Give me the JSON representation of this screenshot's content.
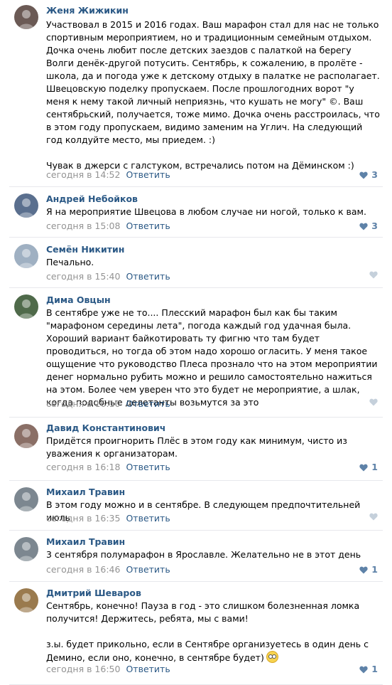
{
  "comments": [
    {
      "author": "Женя Жижикин",
      "text": "Участвовал в 2015 и 2016 годах. Ваш марафон стал для нас не только спортивным мероприятием, но и традиционным семейным отдыхом. Дочка очень любит после детских заездов с палаткой на берегу Волги денёк-другой потусить. Сентябрь, к сожалению, в пролёте - школа, да и погода уже к детскому отдыху в палатке не располагает. Швецовскую поделку пропускаем. После прошлогодних ворот \"у меня к нему такой личный неприязнь, что кушать не могу\" ©. Ваш сентябрьский, получается, тоже мимо. Дочка очень расстроилась, что в этом году пропускаем, видимо заменим на Углич. На следующий год колдуйте место, мы приедем. :)\n\nЧувак в джерси с галстуком, встречались потом на Дёминском :)",
      "time": "сегодня в 14:52",
      "reply": "Ответить",
      "likes": "3",
      "avatar_color": "#6b5a55"
    },
    {
      "author": "Андрей Небойков",
      "text": "Я на мероприятие Швецова в любом случае ни ногой, только к вам.",
      "time": "сегодня в 15:08",
      "reply": "Ответить",
      "likes": "3",
      "avatar_color": "#5a6f8e"
    },
    {
      "author": "Семён Никитин",
      "text": "Печально.",
      "time": "сегодня в 15:40",
      "reply": "Ответить",
      "likes": "",
      "avatar_color": "#9fb0c2"
    },
    {
      "author": "Дима Овцын",
      "text": "В сентябре уже не то.... Плесский марафон был как бы таким \"марафоном середины лета\", погода каждый год удачная была. Хороший вариант байкотировать ту фигню что там будет проводиться, но тогда об этом надо хорошо огласить. У меня такое ощущение что руководство Плеса прознало что на этом мероприятии денег нормально рубить можно и решило самостоятельно нажиться на этом. Более чем уверен что это будет не мероприятие, а шлак, когда подобные делетанты возьмутся за это",
      "time": "сегодня в 16:10",
      "reply": "Ответить",
      "likes": "",
      "avatar_color": "#4f6a4a"
    },
    {
      "author": "Давид Константинович",
      "text": "Придётся проигнорить Плёс в этом году как минимум, чисто из уважения к организаторам.",
      "time": "сегодня в 16:18",
      "reply": "Ответить",
      "likes": "1",
      "avatar_color": "#8a6f66"
    },
    {
      "author": "Михаил Травин",
      "text": "В этом году можно и в сентябре. В следующем предпочтительней июль",
      "time": "сегодня в 16:35",
      "reply": "Ответить",
      "likes": "",
      "avatar_color": "#7c8790"
    },
    {
      "author": "Михаил Травин",
      "text": "3 сентября полумарафон в Ярославле. Желательно не в этот день",
      "time": "сегодня в 16:46",
      "reply": "Ответить",
      "likes": "1",
      "avatar_color": "#7c8790"
    },
    {
      "author": "Дмитрий Шеваров",
      "text": "Сентябрь, конечно! Пауза в год - это слишком болезненная ломка получится! Держитесь, ребята, мы с вами!\n\nз.ы. будет прикольно, если в Сентябре организуетесь в один день с Демино, если оно, конечно, в сентябре будет)",
      "time": "сегодня в 16:50",
      "reply": "Ответить",
      "likes": "1",
      "avatar_color": "#9a7a4e",
      "emoji": "🙄"
    }
  ],
  "colors": {
    "author": "#2a5885",
    "time": "#939393",
    "like": "#5e82a8",
    "like_empty": "#c5d0db",
    "separator": "#e7e8ec"
  }
}
